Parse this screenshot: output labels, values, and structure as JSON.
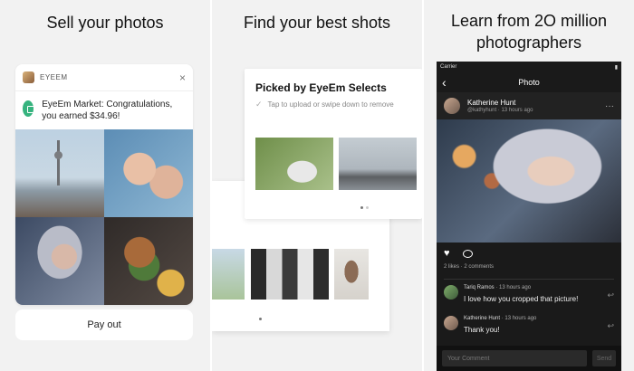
{
  "panels": {
    "sell": {
      "headline": "Sell your photos",
      "notification": {
        "app_name": "EYEEM",
        "close_icon": "×",
        "message": "EyeEm Market: Congratulations, you earned $34.96!"
      },
      "payout_label": "Pay out"
    },
    "find": {
      "headline": "Find your best shots",
      "selects_title": "Picked by EyeEm Selects",
      "selects_hint": "Tap to upload or swipe down to remove",
      "check_icon": "✓"
    },
    "learn": {
      "headline_line1": "Learn from 2O million",
      "headline_line2": "photographers",
      "status": {
        "carrier": "Carrier",
        "wifi_icon": "wifi",
        "battery": "▮"
      },
      "nav_title": "Photo",
      "back_icon": "‹",
      "post": {
        "author": "Katherine Hunt",
        "handle_time": "@kathyhunt · 13 hours ago",
        "more_icon": "···"
      },
      "likes_comments": "2 likes · 2 comments",
      "comments": [
        {
          "name": "Tariq Ramos",
          "time": "· 13 hours ago",
          "text": "I love how you cropped that picture!"
        },
        {
          "name": "Katherine Hunt",
          "time": "· 13 hours ago",
          "text": "Thank you!"
        }
      ],
      "composer": {
        "placeholder": "Your Comment",
        "send_label": "Send"
      }
    }
  },
  "colors": {
    "panel_bg": "#f2f2f2",
    "market_green": "#36b37e",
    "phone_bg": "#1a1a1a"
  }
}
